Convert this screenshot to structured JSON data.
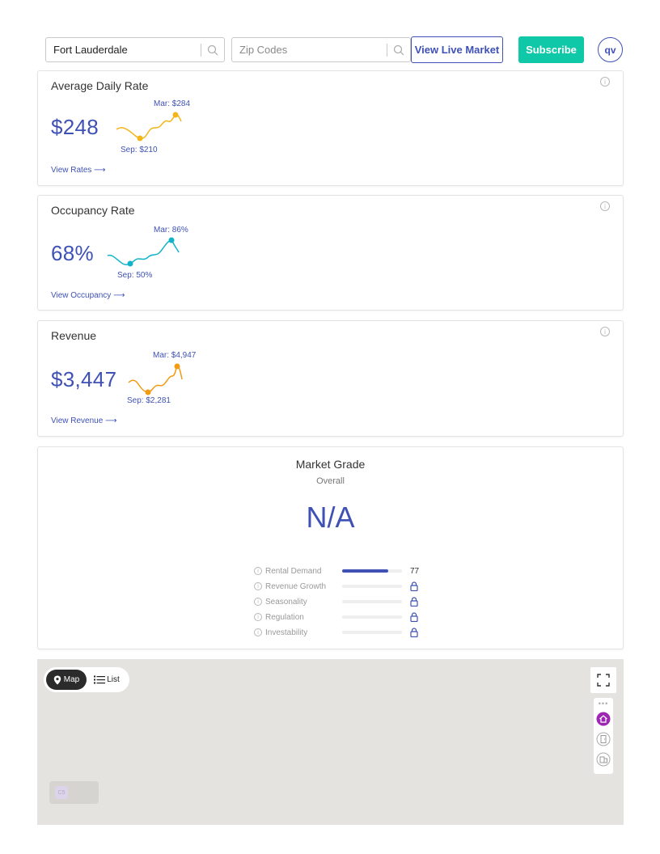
{
  "header": {
    "city_value": "Fort Lauderdale",
    "zip_placeholder": "Zip Codes",
    "view_live_label": "View Live Market",
    "subscribe_label": "Subscribe",
    "avatar_initials": "qv"
  },
  "metrics": [
    {
      "title": "Average Daily Rate",
      "value": "$248",
      "high_label": "Mar: $284",
      "low_label": "Sep: $210",
      "link": "View Rates ⟶",
      "color": "#f2b61a"
    },
    {
      "title": "Occupancy Rate",
      "value": "68%",
      "high_label": "Mar: 86%",
      "low_label": "Sep: 50%",
      "link": "View Occupancy ⟶",
      "color": "#11b3c9"
    },
    {
      "title": "Revenue",
      "value": "$3,447",
      "high_label": "Mar: $4,947",
      "low_label": "Sep: $2,281",
      "link": "View Revenue ⟶",
      "color": "#f29a12"
    }
  ],
  "market_grade": {
    "title": "Market Grade",
    "subtitle": "Overall",
    "value": "N/A",
    "rows": [
      {
        "label": "Rental Demand",
        "score": "77",
        "fill": 0.77,
        "locked": false
      },
      {
        "label": "Revenue Growth",
        "score": "",
        "fill": 0,
        "locked": true
      },
      {
        "label": "Seasonality",
        "score": "",
        "fill": 0,
        "locked": true
      },
      {
        "label": "Regulation",
        "score": "",
        "fill": 0,
        "locked": true
      },
      {
        "label": "Investability",
        "score": "",
        "fill": 0,
        "locked": true
      }
    ]
  },
  "map": {
    "map_label": "Map",
    "list_label": "List",
    "logo_text": "C5",
    "icons": [
      "fullscreen-icon",
      "home-layer-icon",
      "door-layer-icon",
      "building-layer-icon"
    ]
  },
  "colors": {
    "accent": "#3f51b5",
    "subscribe": "#0fc8a7",
    "map_bg": "#e5e3df",
    "layer_active": "#9c27b0"
  }
}
